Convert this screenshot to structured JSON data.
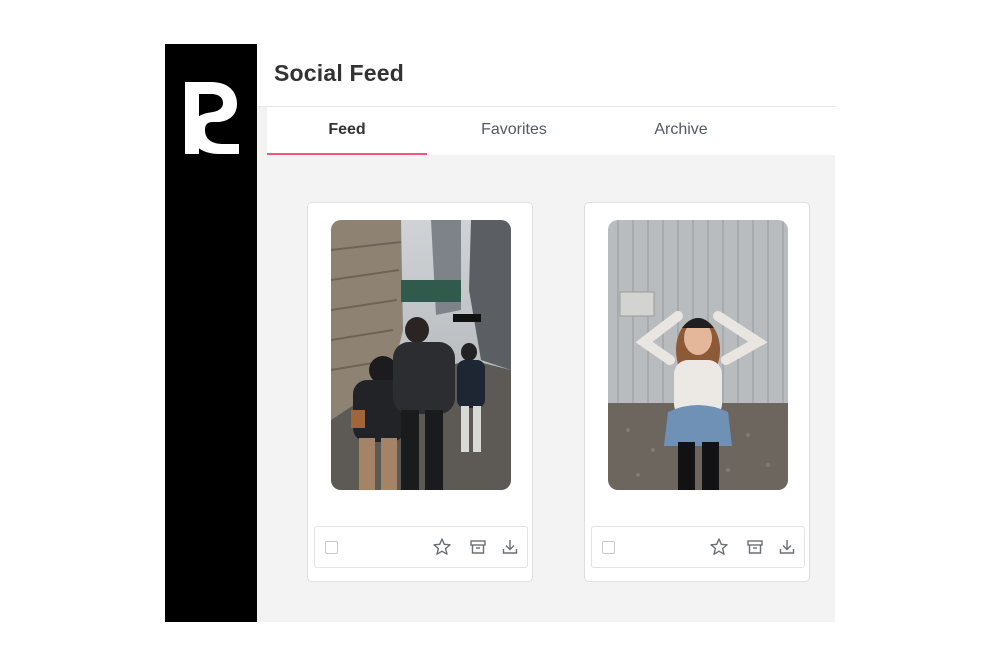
{
  "app": {
    "title": "Social Feed",
    "logo": {
      "icon": "r-brand-logo-icon",
      "color": "#ffffff",
      "background": "#000000"
    }
  },
  "tabs": [
    {
      "label": "Feed",
      "active": true
    },
    {
      "label": "Favorites",
      "active": false
    },
    {
      "label": "Archive",
      "active": false
    }
  ],
  "colors": {
    "accent": "#ea5a7e",
    "title": "#333333",
    "tab_text": "#505a66",
    "content_bg": "#f3f3f4"
  },
  "posts": [
    {
      "image": "street-photo-people-walking-city",
      "selected": false,
      "actions": [
        "star-icon",
        "archive-icon",
        "download-icon"
      ]
    },
    {
      "image": "photo-woman-cap-excited-outdoors",
      "selected": false,
      "actions": [
        "star-icon",
        "archive-icon",
        "download-icon"
      ]
    }
  ]
}
